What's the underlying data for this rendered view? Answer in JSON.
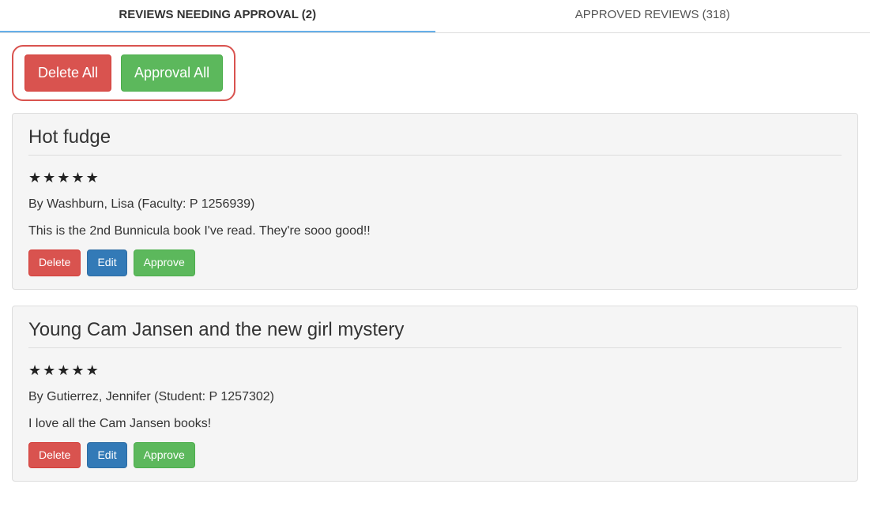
{
  "tabs": {
    "pending": "REVIEWS NEEDING APPROVAL (2)",
    "approved": "APPROVED REVIEWS (318)"
  },
  "bulk": {
    "delete_all": "Delete All",
    "approval_all": "Approval All"
  },
  "buttons": {
    "delete": "Delete",
    "edit": "Edit",
    "approve": "Approve"
  },
  "reviews": [
    {
      "title": "Hot fudge",
      "rating": 5,
      "byline": "By Washburn, Lisa (Faculty: P 1256939)",
      "body": "This is the 2nd Bunnicula book I've read. They're sooo good!!"
    },
    {
      "title": "Young Cam Jansen and the new girl mystery",
      "rating": 5,
      "byline": "By Gutierrez, Jennifer (Student: P 1257302)",
      "body": "I love all the Cam Jansen books!"
    }
  ]
}
